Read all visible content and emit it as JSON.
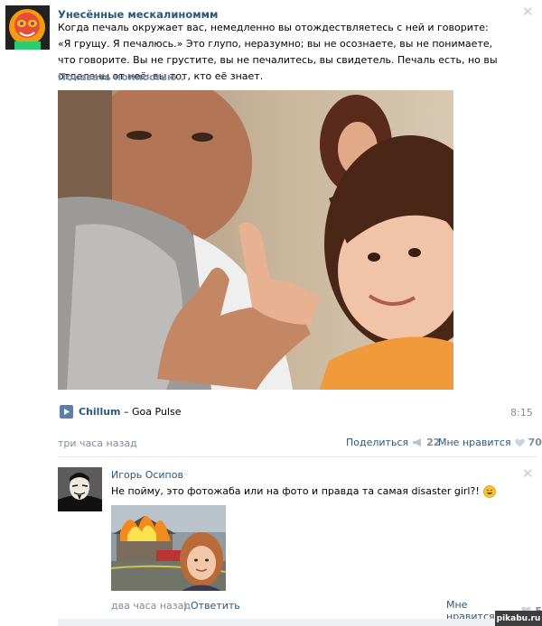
{
  "post": {
    "author": "Унесённые мескалиноммм",
    "text": "Когда печаль окружает вас, немедленно вы отождествляетесь с ней и говорите: «Я грущу. Я печалюсь.» Это глупо, неразумно; вы не осознаете, вы не понимаете, что говорите. Вы не грустите, вы не печалитесь, вы свидетель. Печаль есть, но вы отделены от неё: вы тот, кто её знает.",
    "show_more": "Показать полностью..",
    "audio": {
      "artist": "Chillum",
      "separator": " – ",
      "title": "Goa Pulse",
      "duration": "8:15"
    },
    "time": "три часа назад",
    "share_label": "Поделиться",
    "share_count": "22",
    "like_label": "Мне нравится",
    "like_count": "70"
  },
  "comment": {
    "author": "Игорь Осипов",
    "text": "Не пойму, это фотожаба или на фото и правда та самая disaster girl?!",
    "time": "два часа назад",
    "reply_label": "Ответить",
    "like_label": "Мне нравится",
    "like_count": "5"
  },
  "watermark": "pikabu.ru",
  "colors": {
    "link": "#2b587a",
    "muted": "#7f8c99",
    "show_more": "#7b93ad",
    "divider": "#e0e6ec",
    "play_button": "#5b7fa6"
  },
  "icons": [
    "close-icon",
    "play-icon",
    "megaphone-icon",
    "heart-icon",
    "smile-emoji-icon"
  ]
}
